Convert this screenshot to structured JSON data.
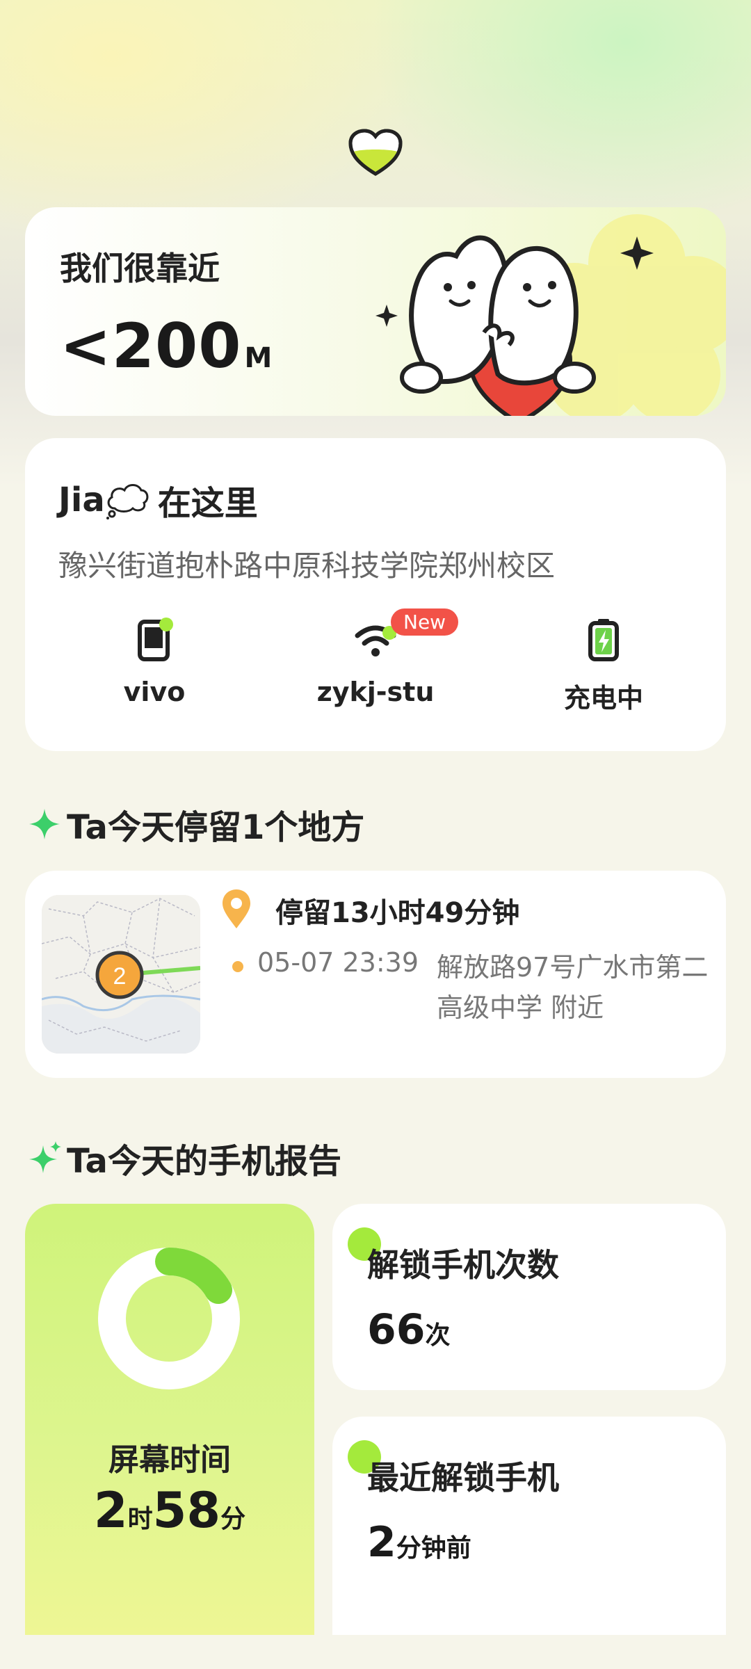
{
  "distance": {
    "title": "我们很靠近",
    "value": "<200",
    "unit": "M"
  },
  "location": {
    "name": "Jia",
    "title_suffix": "在这里",
    "address": "豫兴街道抱朴路中原科技学院郑州校区",
    "items": [
      {
        "label": "vivo",
        "icon": "phone-icon"
      },
      {
        "label": "zykj-stu",
        "icon": "wifi-icon",
        "badge": "New"
      },
      {
        "label": "充电中",
        "icon": "battery-charging-icon"
      }
    ]
  },
  "stay_section": {
    "title": "Ta今天停留1个地方",
    "duration": "停留13小时49分钟",
    "map_marker": "2",
    "time": "05-07 23:39",
    "place": "解放路97号广水市第二高级中学 附近"
  },
  "report_section": {
    "title": "Ta今天的手机报告",
    "screen_time": {
      "label": "屏幕时间",
      "hours": "2",
      "hours_unit": "时",
      "minutes": "58",
      "minutes_unit": "分"
    },
    "unlock_count": {
      "label": "解锁手机次数",
      "value": "66",
      "unit": "次"
    },
    "last_unlock": {
      "label": "最近解锁手机",
      "value": "2",
      "unit": "分钟前"
    }
  },
  "colors": {
    "accent_green": "#a4ea3c",
    "badge_red": "#f25248",
    "pin_orange": "#f7b44c"
  }
}
